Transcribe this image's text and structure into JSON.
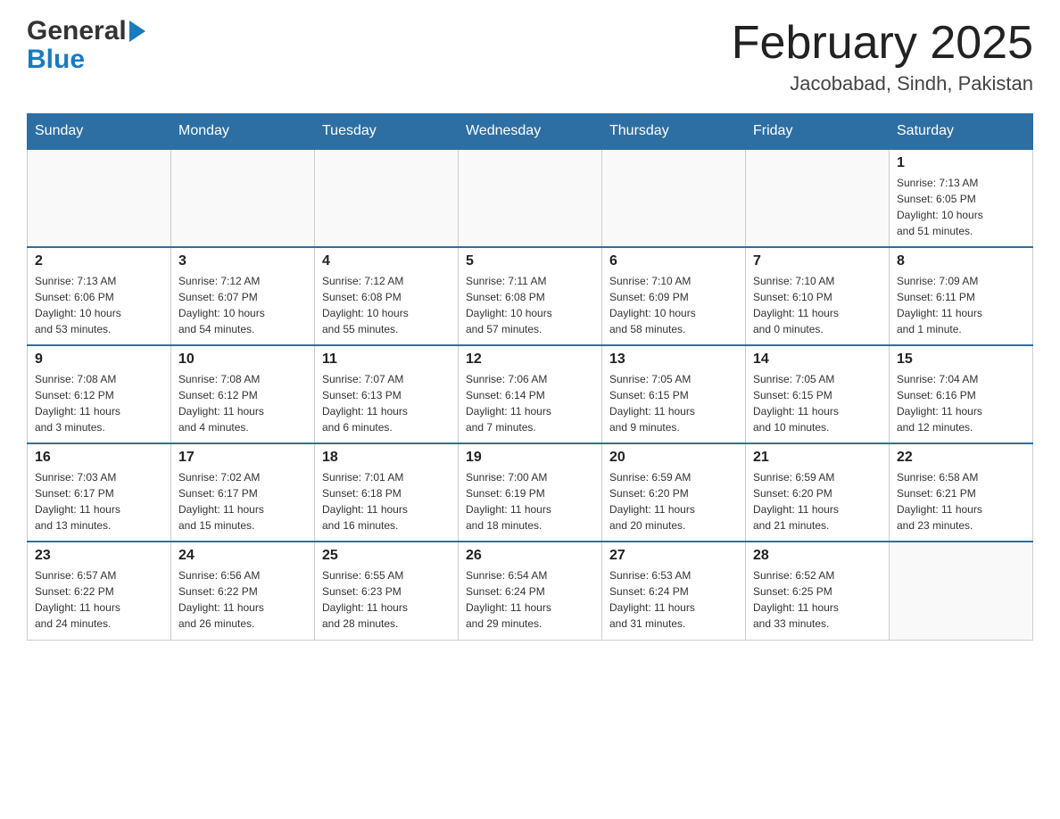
{
  "header": {
    "logo_general": "General",
    "logo_blue": "Blue",
    "month_year": "February 2025",
    "location": "Jacobabad, Sindh, Pakistan"
  },
  "weekdays": [
    "Sunday",
    "Monday",
    "Tuesday",
    "Wednesday",
    "Thursday",
    "Friday",
    "Saturday"
  ],
  "weeks": [
    [
      {
        "day": "",
        "info": ""
      },
      {
        "day": "",
        "info": ""
      },
      {
        "day": "",
        "info": ""
      },
      {
        "day": "",
        "info": ""
      },
      {
        "day": "",
        "info": ""
      },
      {
        "day": "",
        "info": ""
      },
      {
        "day": "1",
        "info": "Sunrise: 7:13 AM\nSunset: 6:05 PM\nDaylight: 10 hours\nand 51 minutes."
      }
    ],
    [
      {
        "day": "2",
        "info": "Sunrise: 7:13 AM\nSunset: 6:06 PM\nDaylight: 10 hours\nand 53 minutes."
      },
      {
        "day": "3",
        "info": "Sunrise: 7:12 AM\nSunset: 6:07 PM\nDaylight: 10 hours\nand 54 minutes."
      },
      {
        "day": "4",
        "info": "Sunrise: 7:12 AM\nSunset: 6:08 PM\nDaylight: 10 hours\nand 55 minutes."
      },
      {
        "day": "5",
        "info": "Sunrise: 7:11 AM\nSunset: 6:08 PM\nDaylight: 10 hours\nand 57 minutes."
      },
      {
        "day": "6",
        "info": "Sunrise: 7:10 AM\nSunset: 6:09 PM\nDaylight: 10 hours\nand 58 minutes."
      },
      {
        "day": "7",
        "info": "Sunrise: 7:10 AM\nSunset: 6:10 PM\nDaylight: 11 hours\nand 0 minutes."
      },
      {
        "day": "8",
        "info": "Sunrise: 7:09 AM\nSunset: 6:11 PM\nDaylight: 11 hours\nand 1 minute."
      }
    ],
    [
      {
        "day": "9",
        "info": "Sunrise: 7:08 AM\nSunset: 6:12 PM\nDaylight: 11 hours\nand 3 minutes."
      },
      {
        "day": "10",
        "info": "Sunrise: 7:08 AM\nSunset: 6:12 PM\nDaylight: 11 hours\nand 4 minutes."
      },
      {
        "day": "11",
        "info": "Sunrise: 7:07 AM\nSunset: 6:13 PM\nDaylight: 11 hours\nand 6 minutes."
      },
      {
        "day": "12",
        "info": "Sunrise: 7:06 AM\nSunset: 6:14 PM\nDaylight: 11 hours\nand 7 minutes."
      },
      {
        "day": "13",
        "info": "Sunrise: 7:05 AM\nSunset: 6:15 PM\nDaylight: 11 hours\nand 9 minutes."
      },
      {
        "day": "14",
        "info": "Sunrise: 7:05 AM\nSunset: 6:15 PM\nDaylight: 11 hours\nand 10 minutes."
      },
      {
        "day": "15",
        "info": "Sunrise: 7:04 AM\nSunset: 6:16 PM\nDaylight: 11 hours\nand 12 minutes."
      }
    ],
    [
      {
        "day": "16",
        "info": "Sunrise: 7:03 AM\nSunset: 6:17 PM\nDaylight: 11 hours\nand 13 minutes."
      },
      {
        "day": "17",
        "info": "Sunrise: 7:02 AM\nSunset: 6:17 PM\nDaylight: 11 hours\nand 15 minutes."
      },
      {
        "day": "18",
        "info": "Sunrise: 7:01 AM\nSunset: 6:18 PM\nDaylight: 11 hours\nand 16 minutes."
      },
      {
        "day": "19",
        "info": "Sunrise: 7:00 AM\nSunset: 6:19 PM\nDaylight: 11 hours\nand 18 minutes."
      },
      {
        "day": "20",
        "info": "Sunrise: 6:59 AM\nSunset: 6:20 PM\nDaylight: 11 hours\nand 20 minutes."
      },
      {
        "day": "21",
        "info": "Sunrise: 6:59 AM\nSunset: 6:20 PM\nDaylight: 11 hours\nand 21 minutes."
      },
      {
        "day": "22",
        "info": "Sunrise: 6:58 AM\nSunset: 6:21 PM\nDaylight: 11 hours\nand 23 minutes."
      }
    ],
    [
      {
        "day": "23",
        "info": "Sunrise: 6:57 AM\nSunset: 6:22 PM\nDaylight: 11 hours\nand 24 minutes."
      },
      {
        "day": "24",
        "info": "Sunrise: 6:56 AM\nSunset: 6:22 PM\nDaylight: 11 hours\nand 26 minutes."
      },
      {
        "day": "25",
        "info": "Sunrise: 6:55 AM\nSunset: 6:23 PM\nDaylight: 11 hours\nand 28 minutes."
      },
      {
        "day": "26",
        "info": "Sunrise: 6:54 AM\nSunset: 6:24 PM\nDaylight: 11 hours\nand 29 minutes."
      },
      {
        "day": "27",
        "info": "Sunrise: 6:53 AM\nSunset: 6:24 PM\nDaylight: 11 hours\nand 31 minutes."
      },
      {
        "day": "28",
        "info": "Sunrise: 6:52 AM\nSunset: 6:25 PM\nDaylight: 11 hours\nand 33 minutes."
      },
      {
        "day": "",
        "info": ""
      }
    ]
  ]
}
